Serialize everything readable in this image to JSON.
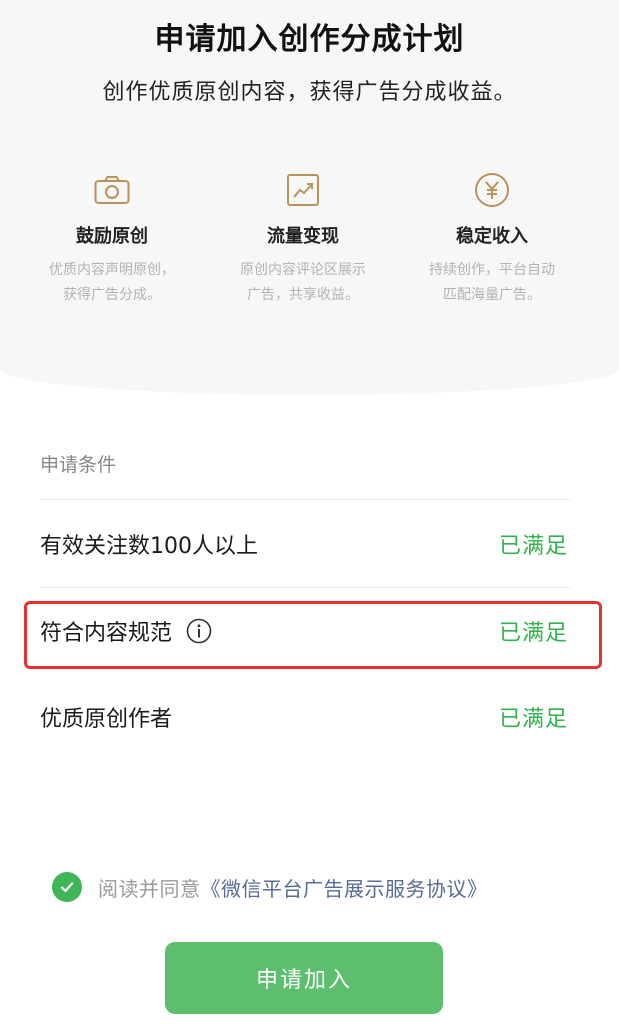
{
  "hero": {
    "title": "申请加入创作分成计划",
    "subtitle": "创作优质原创内容，获得广告分成收益。"
  },
  "features": [
    {
      "icon": "camera-icon",
      "title": "鼓励原创",
      "desc_line1": "优质内容声明原创，",
      "desc_line2": "获得广告分成。"
    },
    {
      "icon": "trend-chart-icon",
      "title": "流量变现",
      "desc_line1": "原创内容评论区展示",
      "desc_line2": "广告，共享收益。"
    },
    {
      "icon": "yen-coin-icon",
      "title": "稳定收入",
      "desc_line1": "持续创作，平台自动",
      "desc_line2": "匹配海量广告。"
    }
  ],
  "conditions": {
    "heading": "申请条件",
    "items": [
      {
        "label": "有效关注数100人以上",
        "status": "已满足"
      },
      {
        "label": "符合内容规范",
        "status": "已满足",
        "has_info_icon": true
      },
      {
        "label": "优质原创作者",
        "status": "已满足"
      }
    ]
  },
  "agreement": {
    "checked": true,
    "prefix": "阅读并同意",
    "link": "《微信平台广告展示服务协议》"
  },
  "apply_button": {
    "label": "申请加入"
  },
  "colors": {
    "accent_gold": "#b8935a",
    "status_green": "#2fb34a",
    "button_green": "#5dbf6d",
    "link_blue": "#566c96",
    "highlight_red": "#e8302c"
  }
}
